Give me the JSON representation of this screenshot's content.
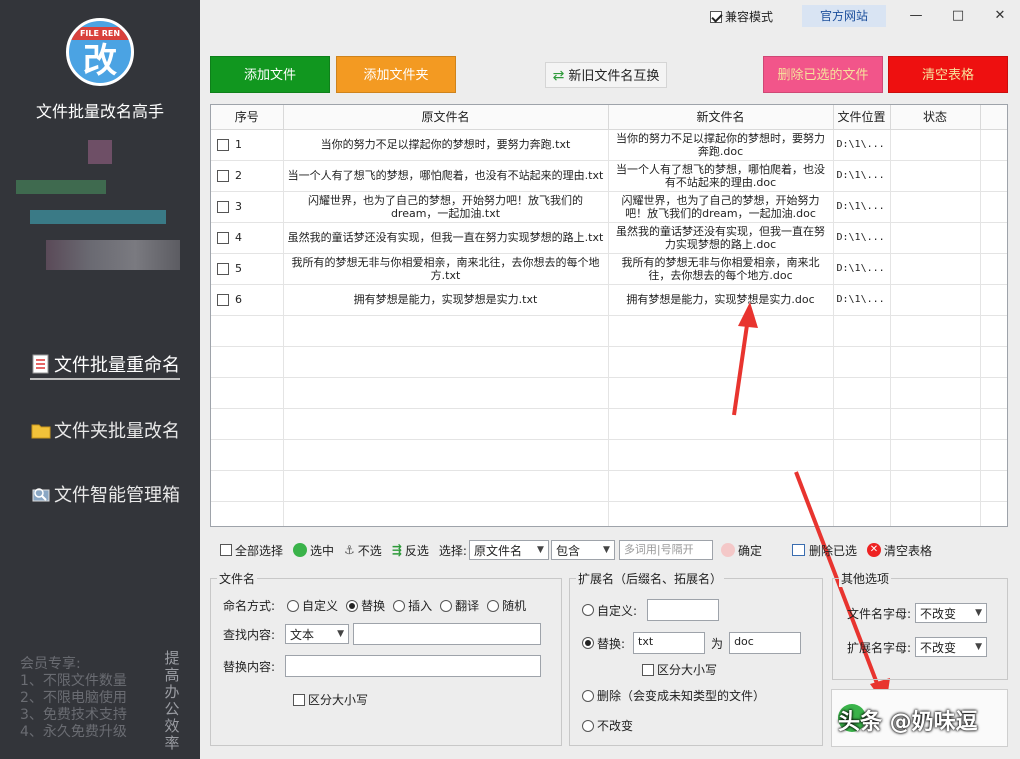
{
  "sidebar": {
    "logo_ribbon": "FILE REN",
    "logo_glyph": "改",
    "app_title": "文件批量改名高手",
    "nav": [
      {
        "label": "文件批量重命名",
        "icon": "document-list-icon"
      },
      {
        "label": "文件夹批量改名",
        "icon": "folder-icon"
      },
      {
        "label": "文件智能管理箱",
        "icon": "toolbox-icon"
      }
    ],
    "member_lines": [
      "会员专享:",
      "1、不限文件数量",
      "2、不限电脑使用",
      "3、免费技术支持",
      "4、永久免费升级"
    ],
    "slogan": "提高办公效率"
  },
  "titlebar": {
    "compat_label": "兼容模式",
    "compat_checked": true,
    "official_label": "官方网站",
    "minimize": "—",
    "maximize": "□",
    "close": "✕"
  },
  "toolbar": {
    "add_file": "添加文件",
    "add_folder": "添加文件夹",
    "swap_names": "新旧文件名互换",
    "delete_selected": "删除已选的文件",
    "clear_table": "清空表格"
  },
  "table": {
    "headers": [
      "序号",
      "原文件名",
      "新文件名",
      "文件位置",
      "状态"
    ],
    "rows": [
      {
        "idx": "1",
        "orig": "当你的努力不足以撑起你的梦想时，要努力奔跑.txt",
        "new": "当你的努力不足以撑起你的梦想时，要努力奔跑.doc",
        "loc": "D:\\1\\...",
        "status": ""
      },
      {
        "idx": "2",
        "orig": "当一个人有了想飞的梦想，哪怕爬着，也没有不站起来的理由.txt",
        "new": "当一个人有了想飞的梦想，哪怕爬着，也没有不站起来的理由.doc",
        "loc": "D:\\1\\...",
        "status": ""
      },
      {
        "idx": "3",
        "orig": "闪耀世界，也为了自己的梦想，开始努力吧！放飞我们的dream，一起加油.txt",
        "new": "闪耀世界，也为了自己的梦想，开始努力吧！放飞我们的dream，一起加油.doc",
        "loc": "D:\\1\\...",
        "status": ""
      },
      {
        "idx": "4",
        "orig": "虽然我的童话梦还没有实现，但我一直在努力实现梦想的路上.txt",
        "new": "虽然我的童话梦还没有实现，但我一直在努力实现梦想的路上.doc",
        "loc": "D:\\1\\...",
        "status": ""
      },
      {
        "idx": "5",
        "orig": "我所有的梦想无非与你相爱相亲，南来北往，去你想去的每个地方.txt",
        "new": "我所有的梦想无非与你相爱相亲，南来北往，去你想去的每个地方.doc",
        "loc": "D:\\1\\...",
        "status": ""
      },
      {
        "idx": "6",
        "orig": "拥有梦想是能力，实现梦想是实力.txt",
        "new": "拥有梦想是能力，实现梦想是实力.doc",
        "loc": "D:\\1\\...",
        "status": ""
      }
    ]
  },
  "selbar": {
    "select_all": "全部选择",
    "select": "选中",
    "deselect": "不选",
    "invert": "反选",
    "choose_label": "选择:",
    "field_value": "原文件名",
    "match_value": "包含",
    "keyword_placeholder": "多词用|号隔开",
    "confirm": "确定",
    "delete_selected": "删除已选",
    "clear_table": "清空表格"
  },
  "filename_group": {
    "title": "文件名",
    "mode_label": "命名方式:",
    "modes": [
      "自定义",
      "替换",
      "插入",
      "翻译",
      "随机"
    ],
    "mode_selected": "替换",
    "find_label": "查找内容:",
    "find_type": "文本",
    "find_value": "",
    "replace_label": "替换内容:",
    "replace_value": "",
    "case_label": "区分大小写"
  },
  "ext_group": {
    "title": "扩展名（后缀名、拓展名）",
    "custom_label": "自定义:",
    "custom_value": "",
    "replace_label": "替换:",
    "replace_from": "txt",
    "to_label": "为",
    "replace_to": "doc",
    "case_label": "区分大小写",
    "delete_label": "删除（会变成未知类型的文件）",
    "keep_label": "不改变"
  },
  "other_group": {
    "title": "其他选项",
    "filename_case_label": "文件名字母:",
    "filename_case_value": "不改变",
    "ext_case_label": "扩展名字母:",
    "ext_case_value": "不改变"
  },
  "watermark": "头条 @奶味逗",
  "colors": {
    "sidebar": "#33353a",
    "add_file": "#11971f",
    "add_folder": "#f39a22",
    "delete_selected": "#f2558a",
    "clear": "#ee1010",
    "arrow": "#e8342f"
  }
}
